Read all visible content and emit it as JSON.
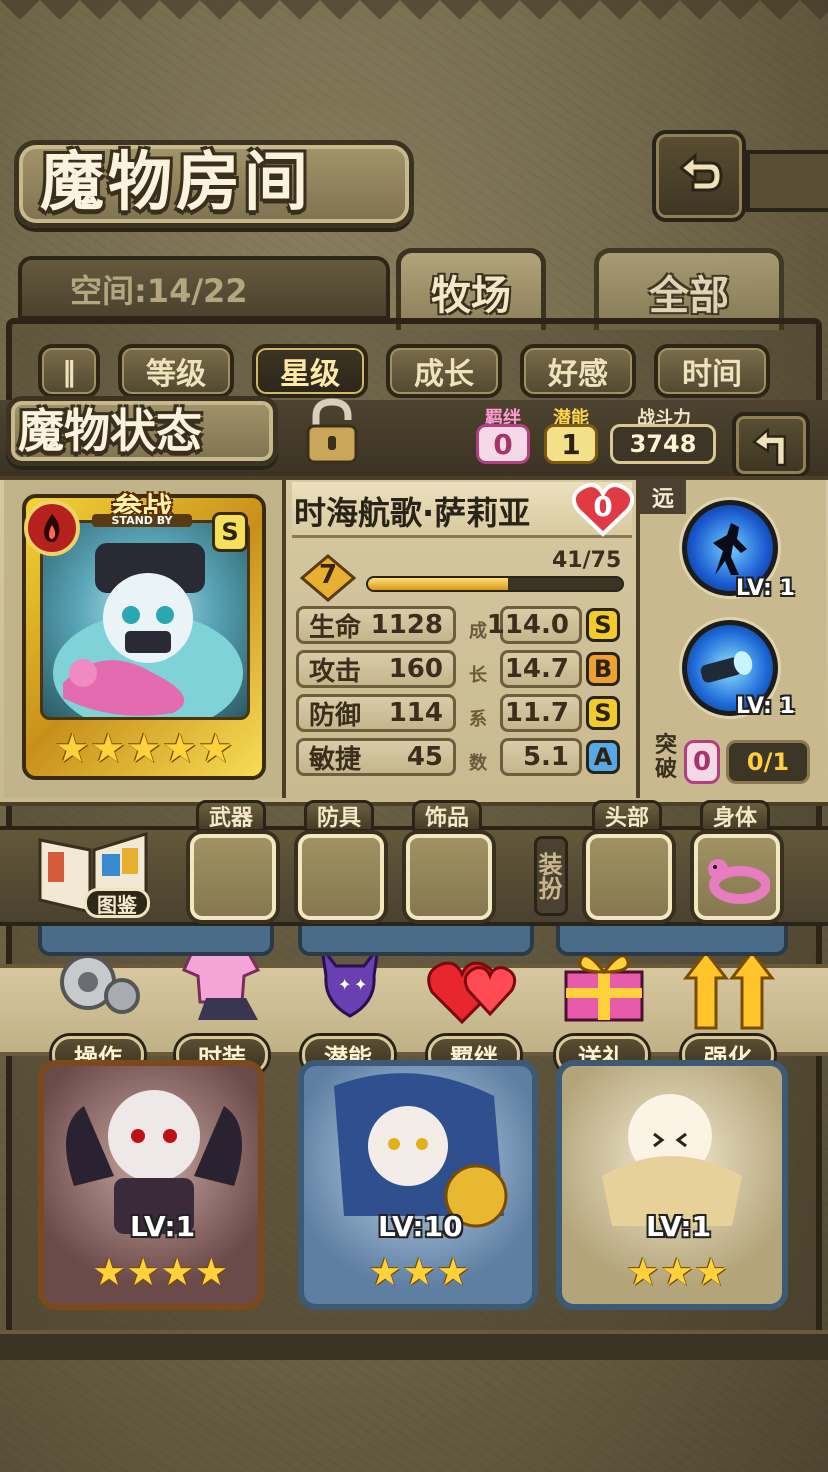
{
  "header": {
    "title": "魔物房间",
    "back_icon": "return-arrow-icon"
  },
  "storage": {
    "space_label": "空间:14/22"
  },
  "tabs": [
    {
      "label": "牧场"
    },
    {
      "label": "全部"
    }
  ],
  "sort": {
    "buttons": [
      "等级",
      "星级",
      "成长",
      "好感",
      "时间"
    ],
    "active": "星级"
  },
  "status": {
    "title": "魔物状态",
    "bond": {
      "label": "羁绊",
      "value": "0"
    },
    "potential": {
      "label": "潜能",
      "value": "1"
    },
    "power": {
      "label": "战斗力",
      "value": "3748"
    }
  },
  "monster": {
    "name": "时海航歌·萨莉亚",
    "heart": "0",
    "level": "7",
    "exp_text": "41/75",
    "exp_fraction": 0.55,
    "card_badge": "参战",
    "card_sub": "STAND BY",
    "rank": "S",
    "stars": 5
  },
  "stats": [
    {
      "name": "生命",
      "value": "1128",
      "growth": "114.0",
      "grade": "S",
      "grade_color": "#f2cc2d"
    },
    {
      "name": "攻击",
      "value": "160",
      "growth": "14.7",
      "grade": "B",
      "grade_color": "#f0a030"
    },
    {
      "name": "防御",
      "value": "114",
      "growth": "11.7",
      "grade": "S",
      "grade_color": "#f2cc2d"
    },
    {
      "name": "敏捷",
      "value": "45",
      "growth": "5.1",
      "grade": "A",
      "grade_color": "#58a8e8"
    }
  ],
  "growth_label": [
    "成",
    "长",
    "系",
    "数"
  ],
  "range_tag": "远",
  "skills": [
    {
      "lv": "LV: 1",
      "icon": "shadow-fighter-skill-icon"
    },
    {
      "lv": "LV: 1",
      "icon": "blue-cannon-skill-icon"
    }
  ],
  "breakthrough": {
    "label": "突破",
    "value": "0",
    "progress": "0/1"
  },
  "equipment": {
    "book_label": "图鉴",
    "slots": [
      "武器",
      "防具",
      "饰品"
    ],
    "dress_label": "装扮",
    "dress_slots": [
      "头部",
      "身体"
    ]
  },
  "actions": [
    "操作",
    "时装",
    "潜能",
    "羁绊",
    "送礼",
    "强化"
  ],
  "cards": [
    {
      "lv": "LV:1",
      "stars": 4
    },
    {
      "lv": "LV:10",
      "stars": 3
    },
    {
      "lv": "LV:1",
      "stars": 3
    }
  ]
}
